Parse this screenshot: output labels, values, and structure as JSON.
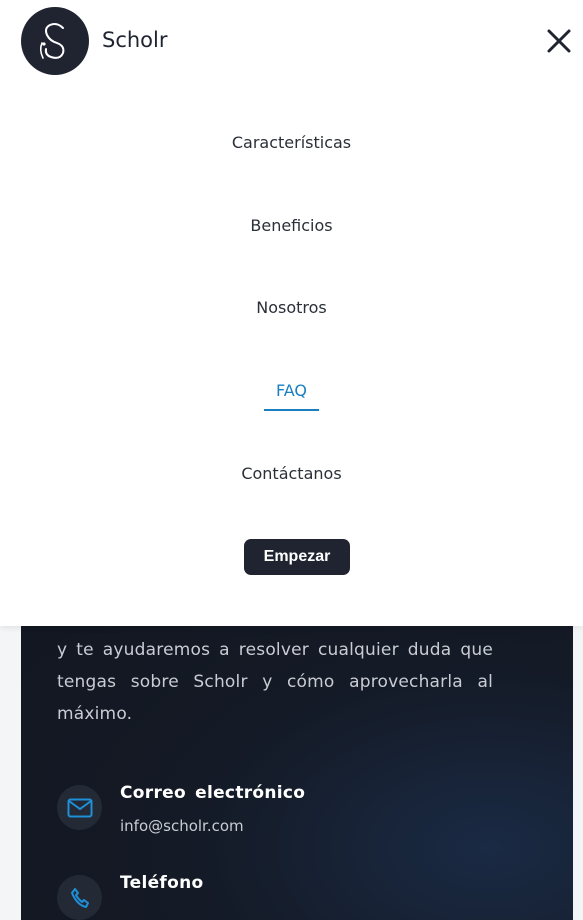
{
  "brand": {
    "name": "Scholr",
    "logo_icon": "scholr-logo-icon",
    "logo_bg": "#1f2430"
  },
  "menu": {
    "close_icon": "close-icon",
    "items": [
      {
        "label": "Características",
        "active": false
      },
      {
        "label": "Beneficios",
        "active": false
      },
      {
        "label": "Nosotros",
        "active": false
      },
      {
        "label": "FAQ",
        "active": true
      },
      {
        "label": "Contáctanos",
        "active": false
      }
    ],
    "cta_label": "Empezar"
  },
  "contact": {
    "paragraph": "y te ayudaremos a resolver cualquier duda que tengas sobre Scholr y cómo aprovecharla al máximo.",
    "email": {
      "icon": "mail-icon",
      "title": "Correo electrónico",
      "value": "info@scholr.com"
    },
    "phone": {
      "icon": "phone-icon",
      "title": "Teléfono"
    }
  },
  "colors": {
    "accent": "#1a7fc1",
    "dark": "#1f2430",
    "card_bg": "#141a26"
  }
}
